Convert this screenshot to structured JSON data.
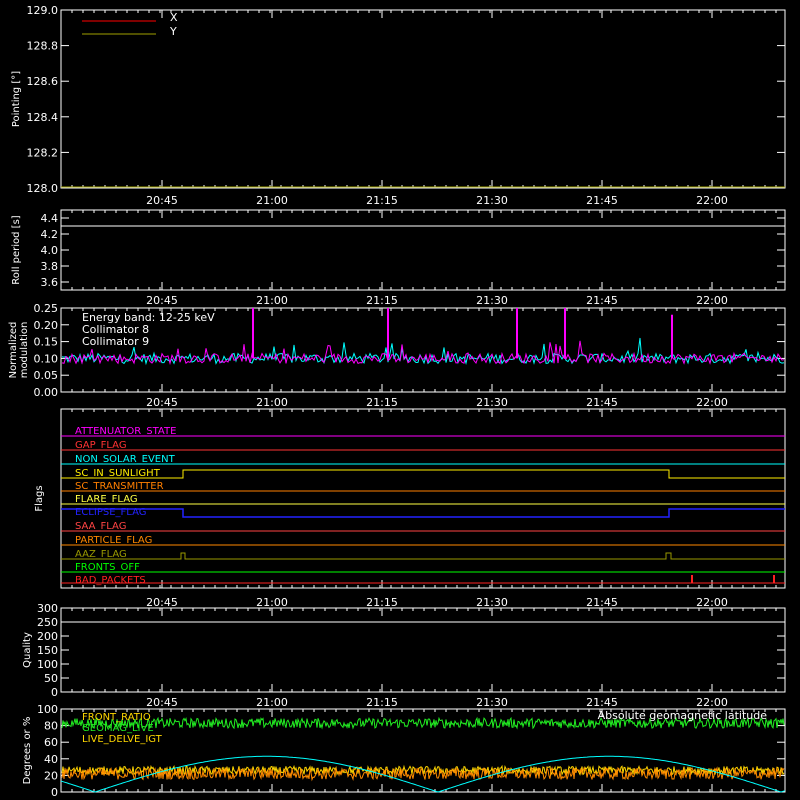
{
  "colors": {
    "background": "#000000",
    "axis": "#ffffff",
    "x": "#ff0000",
    "y": "#a0a000",
    "collimator8": "#00ffff",
    "collimator9": "#ff00ff",
    "front_ratio": "#ffd700",
    "geomag": "#00ffff",
    "green": "#22ee22",
    "orange": "#ff8c00"
  },
  "chart_data": [
    {
      "id": "pointing",
      "type": "line",
      "ylabel": "Pointing [°]",
      "ylim": [
        128.0,
        129.0
      ],
      "yticks": [
        "128.0",
        "128.2",
        "128.4",
        "128.6",
        "128.8",
        "129.0"
      ],
      "yvalues": [
        128.0,
        128.2,
        128.4,
        128.6,
        128.8,
        129.0
      ],
      "xticks": [
        "20:45",
        "21:00",
        "21:15",
        "21:30",
        "21:45",
        "22:00"
      ],
      "series": [
        {
          "name": "X",
          "color": "#ff0000",
          "values": []
        },
        {
          "name": "Y",
          "color": "#a0a000",
          "values": [
            128.0,
            128.0
          ]
        }
      ]
    },
    {
      "id": "roll",
      "type": "line",
      "ylabel": "Roll period [s]",
      "ylim": [
        3.5,
        4.5
      ],
      "yticks": [
        "3.6",
        "3.8",
        "4.0",
        "4.2",
        "4.4"
      ],
      "yvalues": [
        3.6,
        3.8,
        4.0,
        4.2,
        4.4
      ],
      "xticks": [
        "20:45",
        "21:00",
        "21:15",
        "21:30",
        "21:45",
        "22:00"
      ],
      "series": [
        {
          "color": "#ffffff",
          "values": [
            4.3,
            4.3
          ]
        }
      ]
    },
    {
      "id": "modulation",
      "type": "line",
      "ylabel": "Normalized modulation",
      "ylim": [
        0,
        0.25
      ],
      "yticks": [
        "0.00",
        "0.05",
        "0.10",
        "0.15",
        "0.20",
        "0.25"
      ],
      "yvalues": [
        0,
        0.05,
        0.1,
        0.15,
        0.2,
        0.25
      ],
      "xticks": [
        "20:45",
        "21:00",
        "21:15",
        "21:30",
        "21:45",
        "22:00"
      ],
      "legend": [
        "Energy band: 12-25 keV",
        "Collimator 8",
        "Collimator 9"
      ],
      "series": [
        {
          "name": "Collimator 8",
          "color": "#00ffff",
          "baseline": 0.1
        },
        {
          "name": "Collimator 9",
          "color": "#ff00ff",
          "baseline": 0.1,
          "spikes": [
            0.25,
            0.25,
            0.25,
            0.25,
            0.23
          ]
        }
      ]
    },
    {
      "id": "flags",
      "type": "line",
      "ylabel": "Flags",
      "xticks": [
        "20:45",
        "21:00",
        "21:15",
        "21:30",
        "21:45",
        "22:00"
      ],
      "flags": [
        {
          "name": "ATTENUATOR_STATE",
          "color": "#ff00ff"
        },
        {
          "name": "GAP_FLAG",
          "color": "#ff3333"
        },
        {
          "name": "NON_SOLAR_EVENT",
          "color": "#00ffff"
        },
        {
          "name": "SC_IN_SUNLIGHT",
          "color": "#ffee00"
        },
        {
          "name": "SC_TRANSMITTER",
          "color": "#ff7f00"
        },
        {
          "name": "FLARE_FLAG",
          "color": "#ffff44"
        },
        {
          "name": "ECLIPSE_FLAG",
          "color": "#2222ff"
        },
        {
          "name": "SAA_FLAG",
          "color": "#ff4444"
        },
        {
          "name": "PARTICLE_FLAG",
          "color": "#ff8800"
        },
        {
          "name": "AAZ_FLAG",
          "color": "#999900"
        },
        {
          "name": "FRONTS_OFF",
          "color": "#00ff00"
        },
        {
          "name": "BAD_PACKETS",
          "color": "#ff2222"
        }
      ]
    },
    {
      "id": "quality",
      "type": "line",
      "ylabel": "Quality",
      "ylim": [
        0,
        300
      ],
      "yticks": [
        "0",
        "50",
        "100",
        "150",
        "200",
        "250",
        "300"
      ],
      "yvalues": [
        0,
        50,
        100,
        150,
        200,
        250,
        300
      ],
      "xticks": [
        "20:45",
        "21:00",
        "21:15",
        "21:30",
        "21:45",
        "22:00"
      ],
      "series": [
        {
          "color": "#ffffff",
          "values": [
            250,
            250
          ]
        }
      ]
    },
    {
      "id": "geomag",
      "type": "line",
      "ylabel": "Degrees or %",
      "ylim": [
        0,
        100
      ],
      "yticks": [
        "0",
        "20",
        "40",
        "60",
        "80",
        "100"
      ],
      "yvalues": [
        0,
        20,
        40,
        60,
        80,
        100
      ],
      "legend_left": [
        "FRONT_RATIO",
        "GEOMAG_LIVE",
        "LIVE_DELVE_IGT"
      ],
      "legend_right": "Absolute geomagnetic latitude",
      "series": [
        {
          "name": "green",
          "color": "#22ee22",
          "baseline": 83
        },
        {
          "name": "yellow",
          "color": "#ffd700",
          "baseline": 26
        },
        {
          "name": "orange",
          "color": "#ff8c00",
          "baseline": 22
        },
        {
          "name": "Absolute geomagnetic latitude",
          "color": "#00ffff"
        }
      ]
    }
  ]
}
